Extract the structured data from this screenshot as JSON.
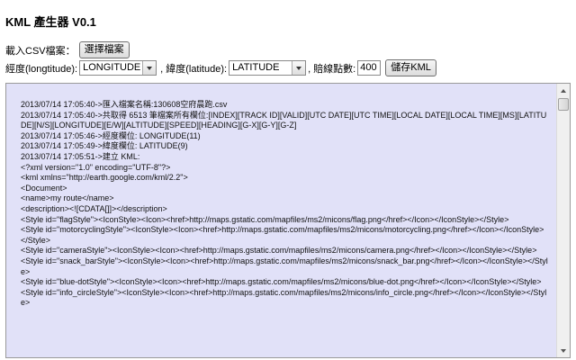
{
  "app": {
    "title": "KML 產生器 V0.1"
  },
  "upload": {
    "label": "載入CSV檔案：",
    "button_label": "選擇檔案"
  },
  "fields": {
    "longitude_label": "經度(longtitude):",
    "longitude_value": "LONGITUDE",
    "latitude_label": ", 緯度(latitude):",
    "latitude_value": "LATITUDE",
    "points_label": ", 賠線點數:",
    "points_value": "400",
    "save_label": "儲存KML"
  },
  "log": {
    "lines": [
      "2013/07/14 17:05:40->匯入檔案名稱:130608空府晨跑.csv",
      "2013/07/14 17:05:40->共取得 6513 筆檔案所有欄位:[INDEX][TRACK ID][VALID][UTC DATE][UTC TIME][LOCAL DATE][LOCAL TIME][MS][LATITUDE][N/S][LONGITUDE][E/W][ALTITUDE][SPEED][HEADING][G-X][G-Y][G-Z]",
      "2013/07/14 17:05:46->經度欄位: LONGITUDE(11)",
      "2013/07/14 17:05:49->緯度欄位: LATITUDE(9)",
      "2013/07/14 17:05:51->建立 KML:",
      "<?xml version=\"1.0\" encoding=\"UTF-8\"?>",
      "<kml xmlns=\"http://earth.google.com/kml/2.2\">",
      "<Document>",
      "<name>my route</name>",
      "<description><![CDATA[]]></description>",
      "<Style id=\"flagStyle\"><IconStyle><Icon><href>http://maps.gstatic.com/mapfiles/ms2/micons/flag.png</href></Icon></IconStyle></Style>",
      "<Style id=\"motorcyclingStyle\"><IconStyle><Icon><href>http://maps.gstatic.com/mapfiles/ms2/micons/motorcycling.png</href></Icon></IconStyle></Style>",
      "<Style id=\"cameraStyle\"><IconStyle><Icon><href>http://maps.gstatic.com/mapfiles/ms2/micons/camera.png</href></Icon></IconStyle></Style>",
      "<Style id=\"snack_barStyle\"><IconStyle><Icon><href>http://maps.gstatic.com/mapfiles/ms2/micons/snack_bar.png</href></Icon></IconStyle></Style>",
      "<Style id=\"blue-dotStyle\"><IconStyle><Icon><href>http://maps.gstatic.com/mapfiles/ms2/micons/blue-dot.png</href></Icon></IconStyle></Style>",
      "<Style id=\"info_circleStyle\"><IconStyle><Icon><href>http://maps.gstatic.com/mapfiles/ms2/micons/info_circle.png</href></Icon></IconStyle></Style>"
    ]
  }
}
